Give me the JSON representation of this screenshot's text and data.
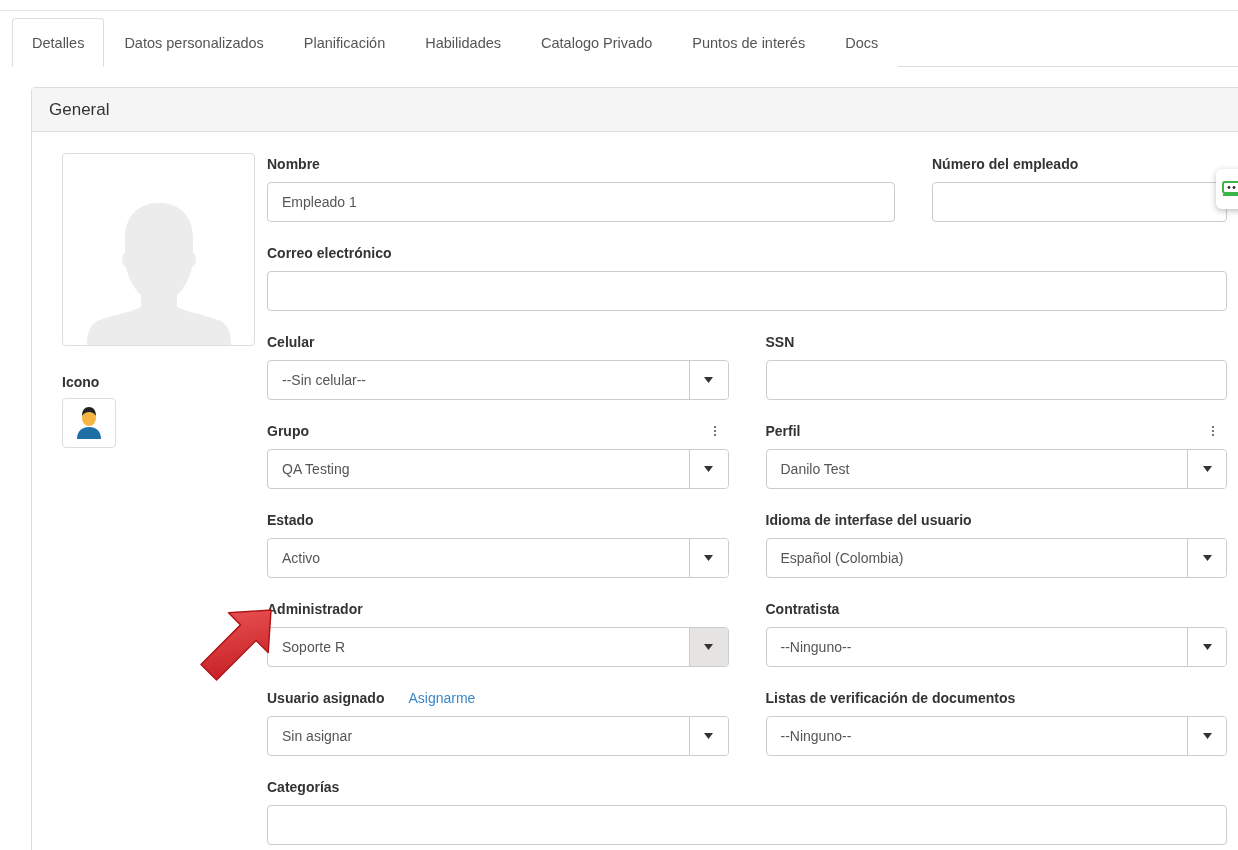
{
  "tabs": [
    {
      "label": "Detalles",
      "selected": true
    },
    {
      "label": "Datos personalizados",
      "selected": false
    },
    {
      "label": "Planificación",
      "selected": false
    },
    {
      "label": "Habilidades",
      "selected": false
    },
    {
      "label": "Catalogo Privado",
      "selected": false
    },
    {
      "label": "Puntos de interés",
      "selected": false
    },
    {
      "label": "Docs",
      "selected": false
    }
  ],
  "panel": {
    "title": "General",
    "icon_label": "Icono",
    "rows": [
      {
        "kind": "wide",
        "fields": [
          {
            "label": "Nombre",
            "kind": "input",
            "value": "Empleado 1"
          },
          {
            "label": "Número del empleado",
            "kind": "input"
          }
        ]
      },
      {
        "kind": "even",
        "fields": [
          {
            "label": "Correo electrónico",
            "kind": "input"
          }
        ]
      },
      {
        "kind": "even",
        "fields": [
          {
            "label": "Celular",
            "kind": "select",
            "value": "--Sin celular--",
            "menu": false,
            "highlighted": false
          },
          {
            "label": "SSN",
            "kind": "input"
          }
        ]
      },
      {
        "kind": "even",
        "fields": [
          {
            "label": "Grupo",
            "kind": "select",
            "value": "QA Testing",
            "menu": true,
            "highlighted": false
          },
          {
            "label": "Perfil",
            "kind": "select",
            "value": "Danilo Test",
            "menu": true,
            "highlighted": false
          }
        ]
      },
      {
        "kind": "even",
        "fields": [
          {
            "label": "Estado",
            "kind": "select",
            "value": "Activo",
            "menu": false,
            "highlighted": false
          },
          {
            "label": "Idioma de interfase del usuario",
            "kind": "select",
            "value": "Español (Colombia)",
            "menu": false,
            "highlighted": false
          }
        ]
      },
      {
        "kind": "even",
        "fields": [
          {
            "label": "Administrador",
            "kind": "select",
            "value": "Soporte R",
            "menu": false,
            "highlighted": true
          },
          {
            "label": "Contratista",
            "kind": "select",
            "value": "--Ninguno--",
            "menu": false,
            "highlighted": false
          }
        ]
      },
      {
        "kind": "even",
        "fields": [
          {
            "label": "Usuario asignado",
            "link": "Asignarme",
            "kind": "select",
            "value": "Sin asignar",
            "menu": false,
            "highlighted": false
          },
          {
            "label": "Listas de verificación de documentos",
            "kind": "select",
            "value": "--Ninguno--",
            "menu": false,
            "highlighted": false
          }
        ]
      },
      {
        "kind": "even",
        "fields": [
          {
            "label": "Categorías",
            "kind": "input"
          }
        ]
      }
    ]
  }
}
